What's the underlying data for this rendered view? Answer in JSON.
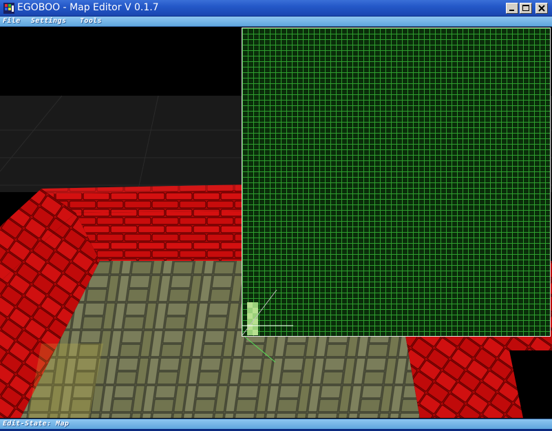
{
  "window": {
    "title": "EGOBOO - Map Editor V 0.1.7",
    "controls": {
      "minimize": "minimize-icon",
      "maximize": "maximize-icon",
      "close": "close-icon"
    }
  },
  "menu": {
    "items": [
      {
        "label": "File"
      },
      {
        "label": "Settings"
      },
      {
        "label": "Tools"
      }
    ]
  },
  "status": {
    "text": "Edit-State: Map"
  },
  "colors": {
    "titlebar": "#2458c8",
    "menubar": "#7db8e8",
    "grid_line": "#2fa02f",
    "grid_bg": "#0a2d0a",
    "selection": "#9ad07a",
    "wall": "#c00808",
    "floor": "#6b6e4e"
  },
  "icons": {
    "app": "egoboo-app-icon"
  }
}
